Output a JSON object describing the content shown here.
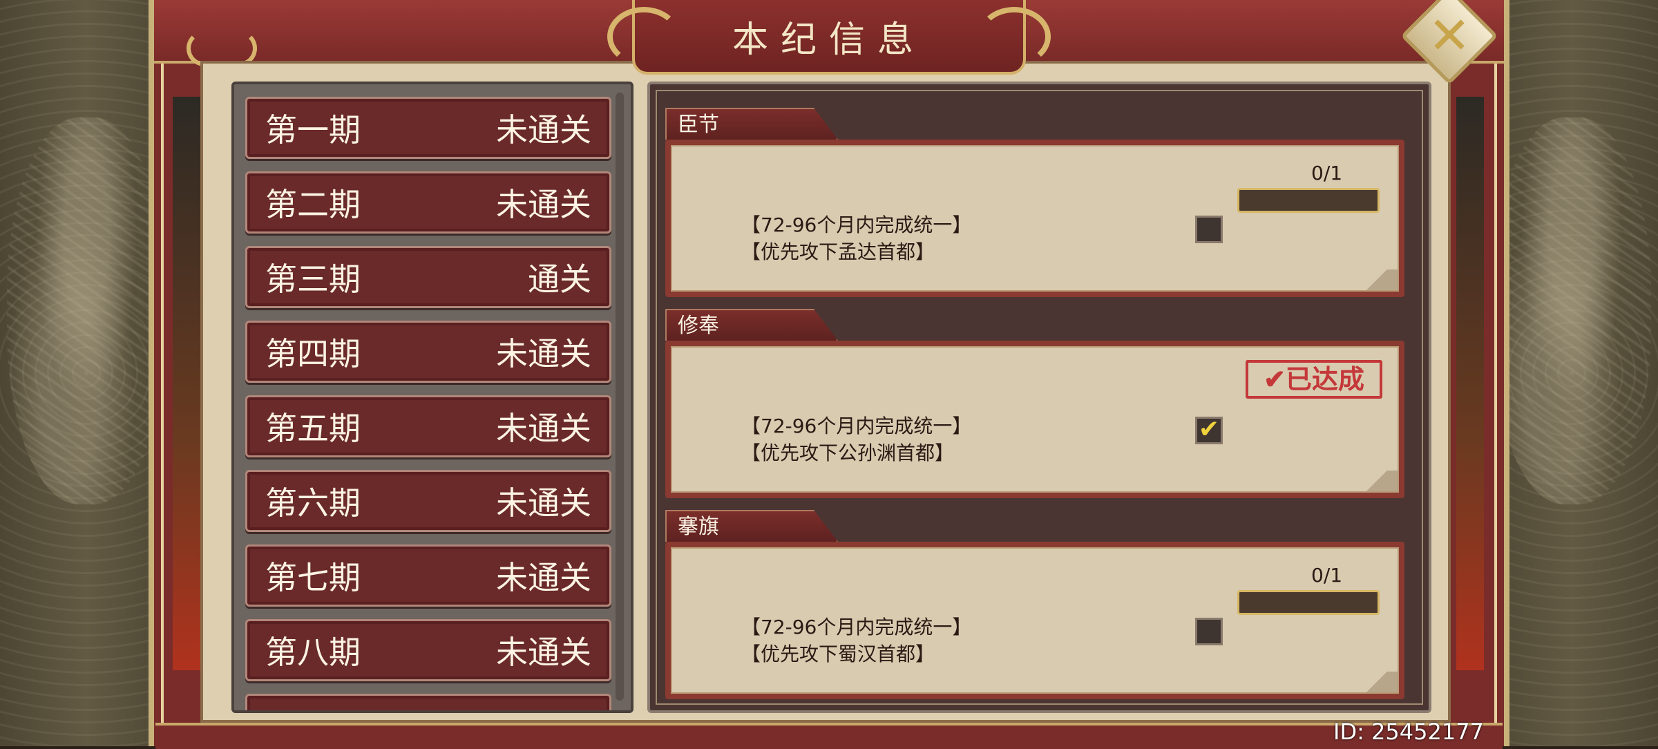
{
  "title": "本纪信息",
  "close": {
    "icon": "close-x-icon",
    "glyph": "✕"
  },
  "periods": [
    {
      "name": "第一期",
      "status": "未通关"
    },
    {
      "name": "第二期",
      "status": "未通关"
    },
    {
      "name": "第三期",
      "status": "通关"
    },
    {
      "name": "第四期",
      "status": "未通关"
    },
    {
      "name": "第五期",
      "status": "未通关"
    },
    {
      "name": "第六期",
      "status": "未通关"
    },
    {
      "name": "第七期",
      "status": "未通关"
    },
    {
      "name": "第八期",
      "status": "未通关"
    }
  ],
  "tasks": [
    {
      "tab": "臣节",
      "line1": "【72-96个月内完成统一】",
      "line2": "【优先攻下孟达首都】",
      "progress_text": "0/1",
      "progress": 0,
      "achieved": false,
      "check": ""
    },
    {
      "tab": "修奉",
      "line1": "【72-96个月内完成统一】",
      "line2": "【优先攻下公孙渊首都】",
      "stamp": "✔已达成",
      "achieved": true,
      "check": "✔"
    },
    {
      "tab": "搴旗",
      "line1": "【72-96个月内完成统一】",
      "line2": "【优先攻下蜀汉首都】",
      "progress_text": "0/1",
      "progress": 0,
      "achieved": false,
      "check": ""
    }
  ],
  "player_id": "ID: 25452177",
  "colors": {
    "frame": "#7a2c2a",
    "paper": "#d9cbb0",
    "gold": "#d6b764",
    "stamp": "#c4383a"
  }
}
